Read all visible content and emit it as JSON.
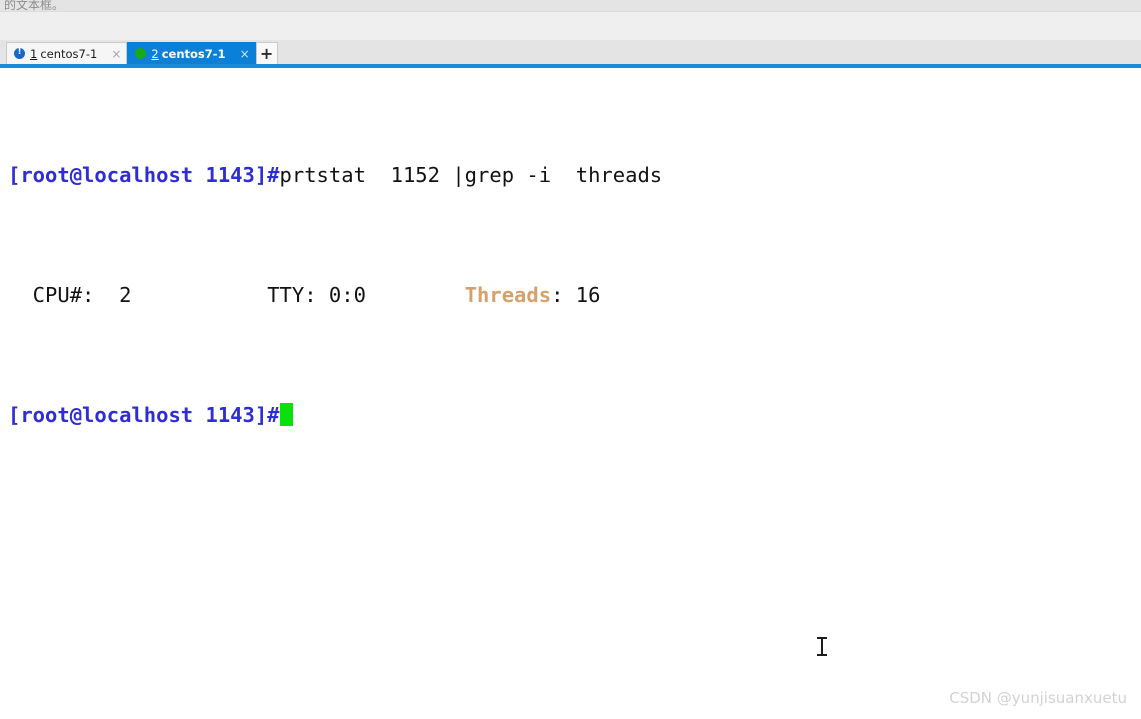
{
  "window": {
    "clipped_top_text": "的文本框。",
    "accent_color": "#0a80d8",
    "underline_color": "#1a8cd8"
  },
  "tabs": {
    "items": [
      {
        "index": "1",
        "title": " centos7-1",
        "status_icon": "alert-circle-icon",
        "close_label": "×",
        "active": false
      },
      {
        "index": "2",
        "title": " centos7-1",
        "status_icon": "green-dot-icon",
        "close_label": "×",
        "active": true
      }
    ],
    "new_tab_label": "+"
  },
  "terminal": {
    "lines": [
      {
        "id": "line1",
        "prompt": "[root@localhost 1143]#",
        "command": "prtstat  1152 |grep -i  threads"
      },
      {
        "id": "line2",
        "col_cpu": "  CPU#:  2",
        "gap1": "           ",
        "col_tty": "TTY: 0:0",
        "gap2": "        ",
        "col_threads_label": "Threads",
        "col_threads_value": ": 16"
      },
      {
        "id": "line3",
        "prompt": "[root@localhost 1143]#"
      }
    ],
    "colors": {
      "prompt": "#2e2ed2",
      "text": "#121212",
      "grep_match": "#d6a06a",
      "cursor": "#0ae00a",
      "background": "#ffffff"
    }
  },
  "watermark": {
    "text": "CSDN @yunjisuanxuetu"
  }
}
